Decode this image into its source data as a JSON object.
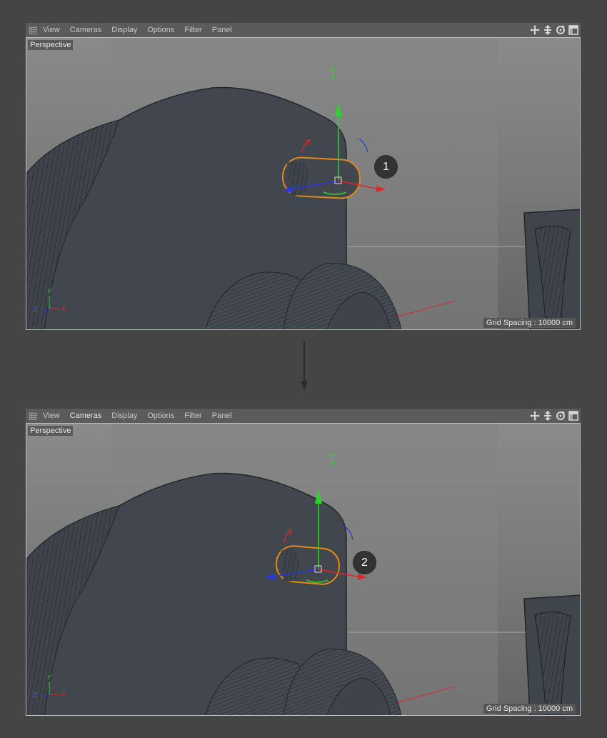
{
  "menu": {
    "view": "View",
    "cameras": "Cameras",
    "display": "Display",
    "options": "Options",
    "filter": "Filter",
    "panel": "Panel"
  },
  "icons": [
    "move-view-icon",
    "pan-view-icon",
    "rotate-view-icon",
    "toggle-panel-icon"
  ],
  "top_viewport": {
    "label": "Perspective",
    "grid_spacing": "Grid Spacing : 10000 cm",
    "step": "1",
    "axis_labels": {
      "x": "X",
      "y": "Y",
      "z": "Z"
    }
  },
  "bottom_viewport": {
    "label": "Perspective",
    "grid_spacing": "Grid Spacing : 10000 cm",
    "step": "2",
    "axis_labels": {
      "x": "X",
      "y": "Y",
      "z": "Z"
    }
  },
  "colors": {
    "background": "#454545",
    "selection_outline": "#e08a1e",
    "axis_x": "#e0262a",
    "axis_y": "#2fd12f",
    "axis_z": "#2637e0"
  }
}
